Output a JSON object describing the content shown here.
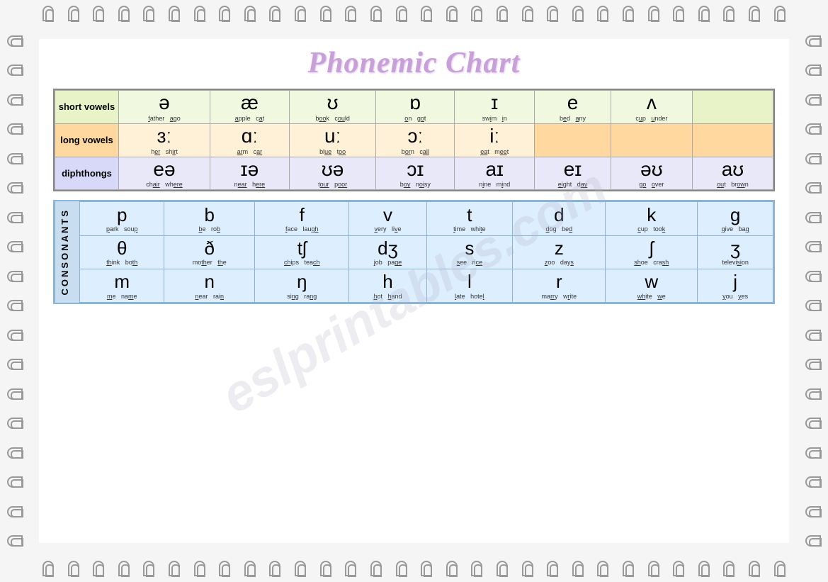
{
  "title": "Phonemic Chart",
  "vowels": {
    "short_label": "short vowels",
    "long_label": "long vowels",
    "diph_label": "diphthongs",
    "short_row": [
      {
        "symbol": "ə",
        "words": [
          "father",
          "ago"
        ]
      },
      {
        "symbol": "æ",
        "words": [
          "apple",
          "cat"
        ]
      },
      {
        "symbol": "ʊ",
        "words": [
          "book",
          "could"
        ]
      },
      {
        "symbol": "ɒ",
        "words": [
          "on",
          "got"
        ]
      },
      {
        "symbol": "ɪ",
        "words": [
          "swim",
          "in"
        ]
      },
      {
        "symbol": "e",
        "words": [
          "bed",
          "any"
        ]
      },
      {
        "symbol": "ʌ",
        "words": [
          "cup",
          "under"
        ]
      },
      {
        "symbol": "",
        "words": []
      }
    ],
    "long_row": [
      {
        "symbol": "ɜː",
        "words": [
          "her",
          "shirt"
        ]
      },
      {
        "symbol": "ɑː",
        "words": [
          "arm",
          "car"
        ]
      },
      {
        "symbol": "uː",
        "words": [
          "blue",
          "too"
        ]
      },
      {
        "symbol": "ɔː",
        "words": [
          "born",
          "call"
        ]
      },
      {
        "symbol": "iː",
        "words": [
          "eat",
          "meet"
        ]
      },
      {
        "symbol": "",
        "words": []
      },
      {
        "symbol": "",
        "words": []
      },
      {
        "symbol": "",
        "words": []
      }
    ],
    "diph_row": [
      {
        "symbol": "eə",
        "words": [
          "chair",
          "where"
        ]
      },
      {
        "symbol": "ɪə",
        "words": [
          "near",
          "here"
        ]
      },
      {
        "symbol": "ʊə",
        "words": [
          "tour",
          "poor"
        ]
      },
      {
        "symbol": "ɔɪ",
        "words": [
          "boy",
          "noisy"
        ]
      },
      {
        "symbol": "aɪ",
        "words": [
          "nine",
          "mind"
        ]
      },
      {
        "symbol": "eɪ",
        "words": [
          "eight",
          "day"
        ]
      },
      {
        "symbol": "əʊ",
        "words": [
          "go",
          "over"
        ]
      },
      {
        "symbol": "aʊ",
        "words": [
          "out",
          "brown"
        ]
      }
    ]
  },
  "consonants": {
    "label": "CONSONANTS",
    "row1": [
      {
        "symbol": "p",
        "words": [
          "park",
          "soup"
        ]
      },
      {
        "symbol": "b",
        "words": [
          "be",
          "rob"
        ]
      },
      {
        "symbol": "f",
        "words": [
          "face",
          "laugh"
        ]
      },
      {
        "symbol": "v",
        "words": [
          "very",
          "live"
        ]
      },
      {
        "symbol": "t",
        "words": [
          "time",
          "white"
        ]
      },
      {
        "symbol": "d",
        "words": [
          "dog",
          "bed"
        ]
      },
      {
        "symbol": "k",
        "words": [
          "cup",
          "took"
        ]
      },
      {
        "symbol": "g",
        "words": [
          "give",
          "bag"
        ]
      }
    ],
    "row2": [
      {
        "symbol": "θ",
        "words": [
          "think",
          "both"
        ]
      },
      {
        "symbol": "ð",
        "words": [
          "mother",
          "the"
        ]
      },
      {
        "symbol": "tʃ",
        "words": [
          "chips",
          "teach"
        ]
      },
      {
        "symbol": "dʒ",
        "words": [
          "job",
          "page"
        ]
      },
      {
        "symbol": "s",
        "words": [
          "see",
          "rice"
        ]
      },
      {
        "symbol": "z",
        "words": [
          "zoo",
          "days"
        ]
      },
      {
        "symbol": "ʃ",
        "words": [
          "shoe",
          "crash"
        ]
      },
      {
        "symbol": "ʒ",
        "words": [
          "television"
        ]
      }
    ],
    "row3": [
      {
        "symbol": "m",
        "words": [
          "me",
          "name"
        ]
      },
      {
        "symbol": "n",
        "words": [
          "near",
          "rain"
        ]
      },
      {
        "symbol": "ŋ",
        "words": [
          "sing",
          "rang"
        ]
      },
      {
        "symbol": "h",
        "words": [
          "hot",
          "hand"
        ]
      },
      {
        "symbol": "l",
        "words": [
          "late",
          "hotel"
        ]
      },
      {
        "symbol": "r",
        "words": [
          "marry",
          "write"
        ]
      },
      {
        "symbol": "w",
        "words": [
          "white",
          "we"
        ]
      },
      {
        "symbol": "j",
        "words": [
          "you",
          "yes"
        ]
      }
    ]
  },
  "watermark": "eslprintables.com"
}
